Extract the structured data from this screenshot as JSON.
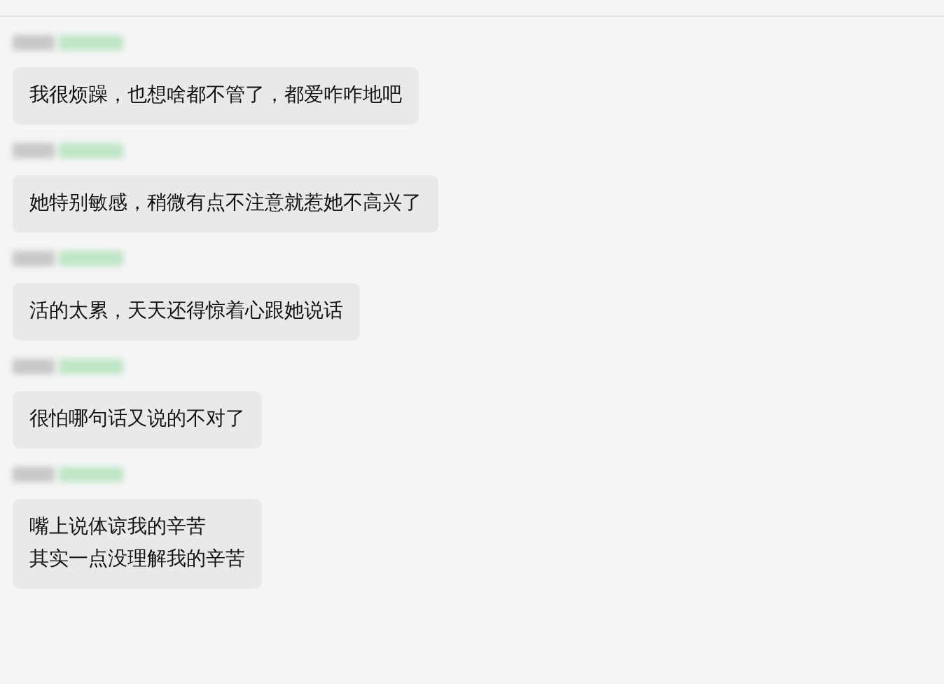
{
  "messages": [
    {
      "lines": [
        "我很烦躁，也想啥都不管了，都爱咋咋地吧"
      ]
    },
    {
      "lines": [
        "她特别敏感，稍微有点不注意就惹她不高兴了"
      ]
    },
    {
      "lines": [
        "活的太累，天天还得惊着心跟她说话"
      ]
    },
    {
      "lines": [
        "很怕哪句话又说的不对了"
      ]
    },
    {
      "lines": [
        "嘴上说体谅我的辛苦",
        "其实一点没理解我的辛苦"
      ]
    }
  ]
}
